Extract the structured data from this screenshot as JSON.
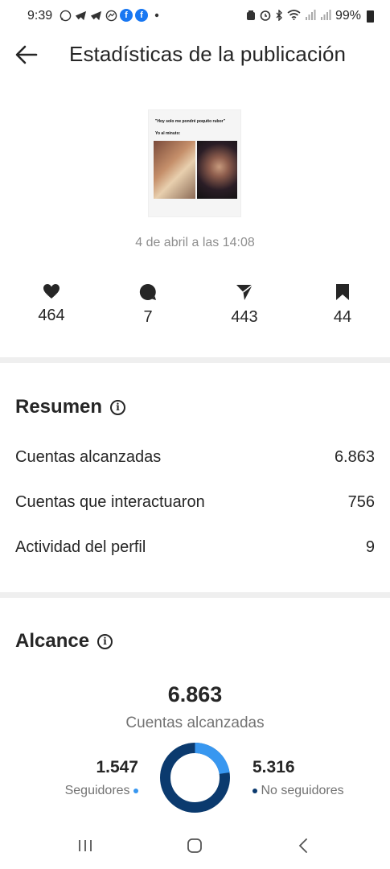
{
  "status_bar": {
    "time": "9:39",
    "battery": "99%",
    "left_icons": [
      "whatsapp-icon",
      "telegram-icon",
      "telegram-icon",
      "messenger-icon",
      "facebook-icon",
      "facebook-icon",
      "dot-icon"
    ],
    "right_icons": [
      "alarm-icon",
      "bluetooth-icon",
      "wifi-icon",
      "signal-icon",
      "signal-icon",
      "battery-icon"
    ]
  },
  "header": {
    "title": "Estadísticas de la publicación",
    "back_icon": "arrow-left-icon"
  },
  "post": {
    "caption_line1": "\"Hoy solo me pondré poquito rubor\"",
    "caption_line2": "Yo al minuto:",
    "date": "4 de abril a las 14:08"
  },
  "metrics": {
    "likes": "464",
    "comments": "7",
    "shares": "443",
    "saves": "44"
  },
  "summary": {
    "title": "Resumen",
    "rows": [
      {
        "label": "Cuentas alcanzadas",
        "value": "6.863"
      },
      {
        "label": "Cuentas que interactuaron",
        "value": "756"
      },
      {
        "label": "Actividad del perfil",
        "value": "9"
      }
    ]
  },
  "reach": {
    "title": "Alcance",
    "total": "6.863",
    "total_label": "Cuentas alcanzadas",
    "followers_value": "1.547",
    "followers_label": "Seguidores",
    "non_followers_value": "5.316",
    "non_followers_label": "No seguidores",
    "followers_fraction": 0.2254,
    "followers_color": "#3897f0",
    "non_followers_color": "#0b3a6e"
  }
}
